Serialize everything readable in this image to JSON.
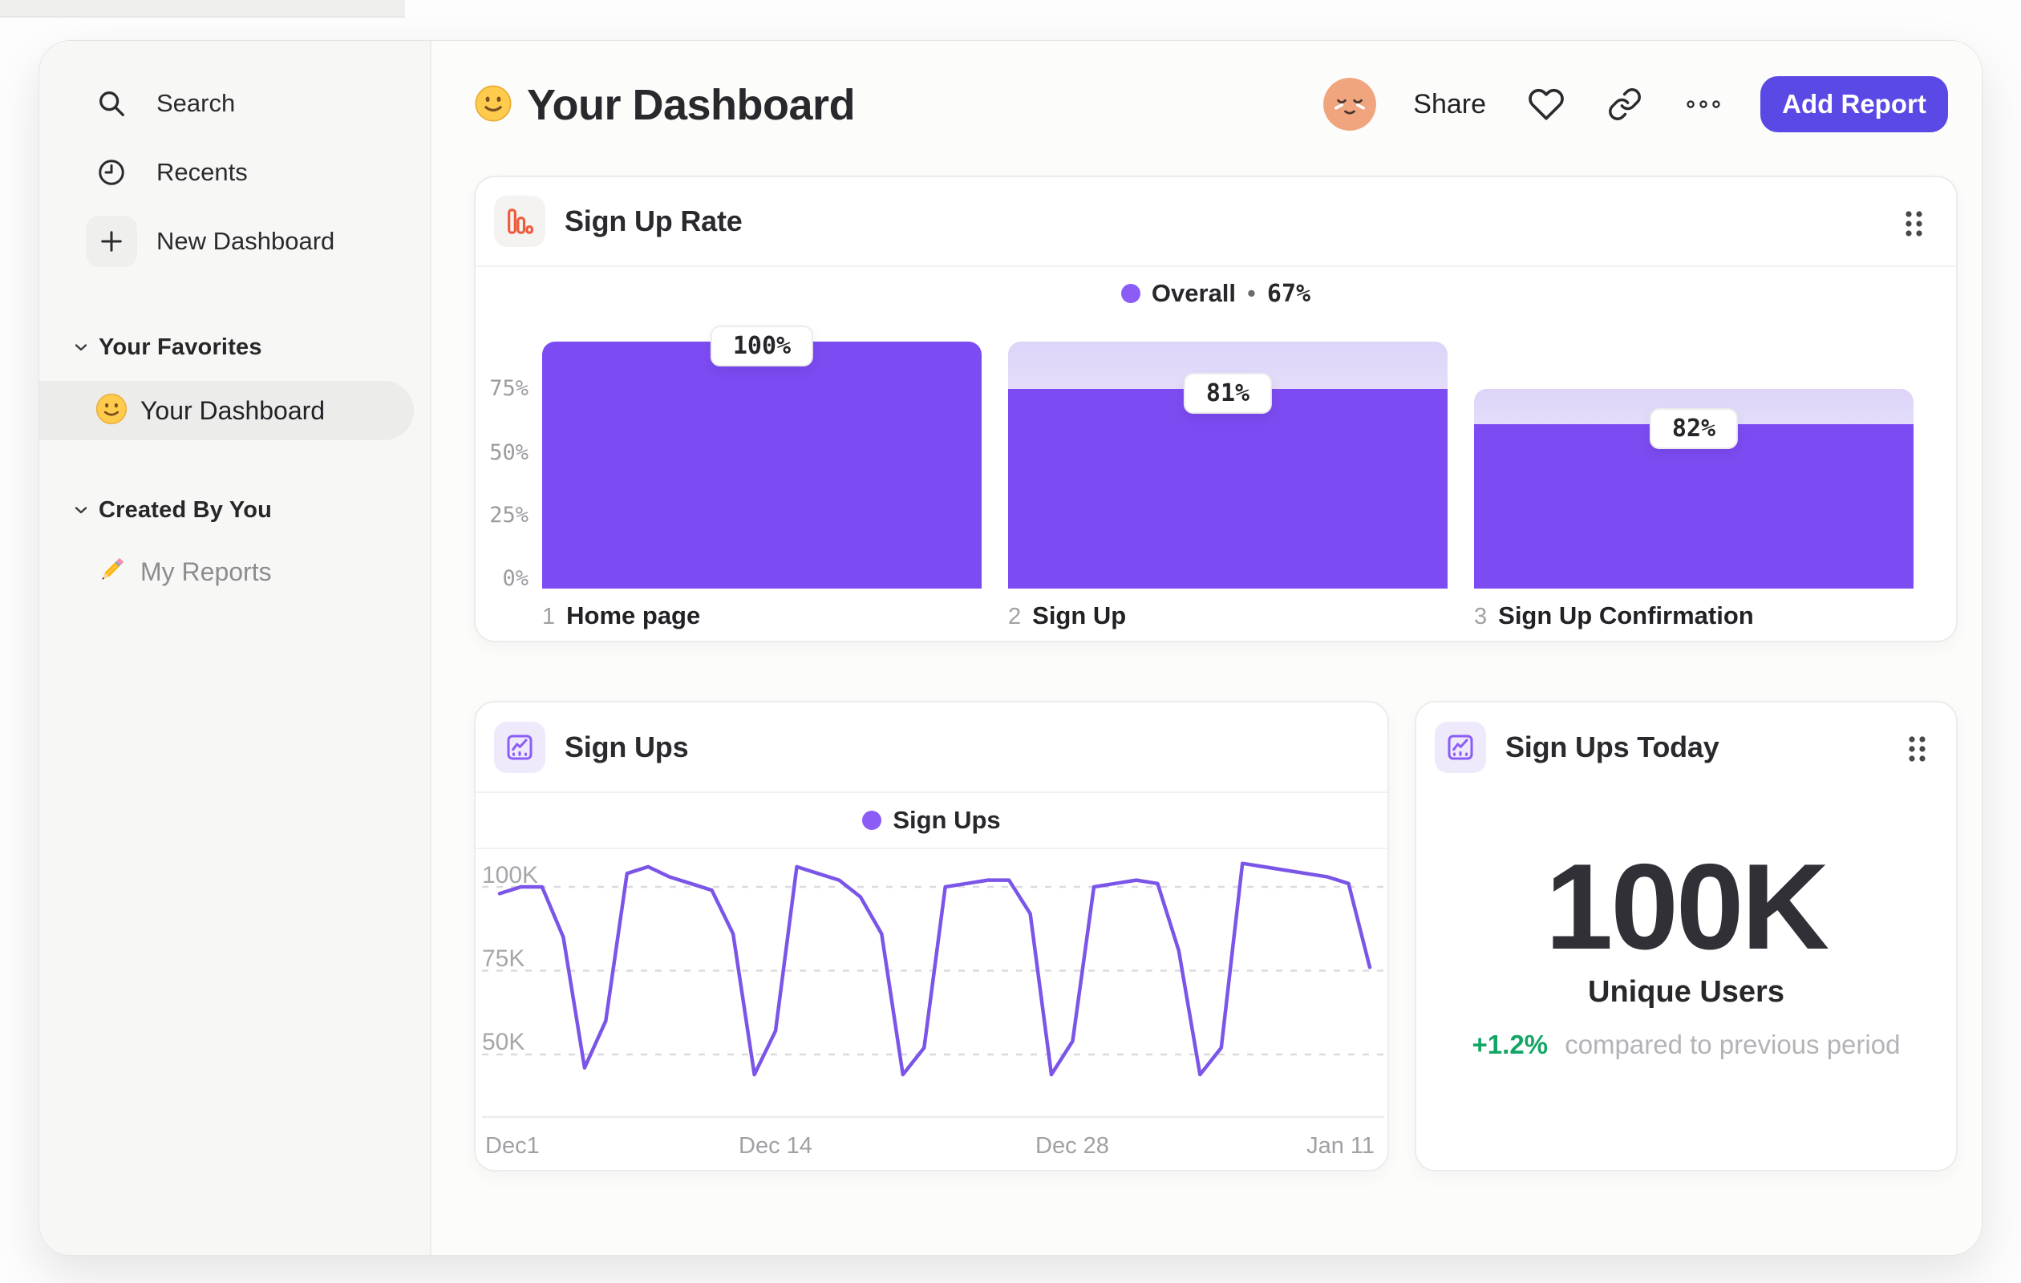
{
  "colors": {
    "funnel_bar_purple": "#7C4BF2",
    "funnel_gradient_top": "#DDD4F8",
    "line_purple": "#7B55E8",
    "legend_dot_purple": "#8B5CF6",
    "button_indigo": "#5A49E4",
    "funnel_icon_orange": "#EE5A3C",
    "positive_green": "#12A564",
    "text_dark": "#2A2A2E",
    "text_gray": "#9B9BA0",
    "sidebar_bg": "#F7F7F5"
  },
  "sidebar": {
    "items": [
      {
        "icon": "search-icon",
        "label": "Search"
      },
      {
        "icon": "clock-icon",
        "label": "Recents"
      },
      {
        "icon": "plus-icon",
        "label": "New Dashboard"
      }
    ],
    "sections": [
      {
        "label": "Your Favorites",
        "items": [
          {
            "icon": "smiley-emoji",
            "label": "Your Dashboard",
            "selected": true
          }
        ]
      },
      {
        "label": "Created By You",
        "items": [
          {
            "icon": "pencil-emoji",
            "label": "My Reports",
            "selected": false
          }
        ]
      }
    ]
  },
  "header": {
    "emoji": "slightly-smiling-face",
    "title": "Your Dashboard",
    "share_label": "Share",
    "add_report_label": "Add Report",
    "icons": [
      "avatar",
      "heart-icon",
      "link-icon",
      "more-icon"
    ]
  },
  "cards": {
    "funnel": {
      "title": "Sign Up Rate",
      "legend_sep": "•"
    },
    "line": {
      "title": "Sign Ups"
    },
    "big_number": {
      "title": "Sign Ups Today"
    }
  },
  "chart_data": [
    {
      "type": "bar",
      "subtype": "funnel",
      "title": "Sign Up Rate",
      "legend": "Overall",
      "overall_conversion": "67%",
      "legend_position": "top-center",
      "categories": [
        "Home page",
        "Sign Up",
        "Sign Up Confirmation"
      ],
      "step_numbers": [
        "1",
        "2",
        "3"
      ],
      "step_conversion_labels": [
        "100%",
        "81%",
        "82%"
      ],
      "solid_heights_pct": [
        100,
        81,
        66.4
      ],
      "column_heights_pct": [
        100,
        100,
        81
      ],
      "y_ticks": [
        "0%",
        "25%",
        "50%",
        "75%"
      ],
      "ylim": [
        0,
        100
      ],
      "grid": false
    },
    {
      "type": "line",
      "title": "Sign Ups",
      "legend_position": "top-center",
      "series": [
        {
          "name": "Sign Ups",
          "values": [
            98,
            100,
            100,
            85,
            46,
            60,
            104,
            106,
            103,
            101,
            99,
            86,
            44,
            57,
            106,
            104,
            102,
            97,
            86,
            44,
            52,
            100,
            101,
            102,
            102,
            92,
            44,
            54,
            100,
            101,
            102,
            101,
            81,
            44,
            52,
            107,
            106,
            105,
            104,
            103,
            101,
            76
          ]
        }
      ],
      "units": "K",
      "x_ticks": [
        "Dec1",
        "Dec 14",
        "Dec 28",
        "Jan 11"
      ],
      "x_tick_positions": [
        0,
        13,
        27,
        41
      ],
      "y_ticks": [
        "100K",
        "75K",
        "50K"
      ],
      "y_tick_values": [
        100,
        75,
        50
      ],
      "grid": "dashed-horizontal",
      "ylim_visible": [
        31,
        110
      ]
    },
    {
      "type": "big_number",
      "title": "Sign Ups Today",
      "value": "100K",
      "label": "Unique Users",
      "delta": "+1.2%",
      "delta_direction": "up",
      "comparison": "compared to previous period"
    }
  ]
}
